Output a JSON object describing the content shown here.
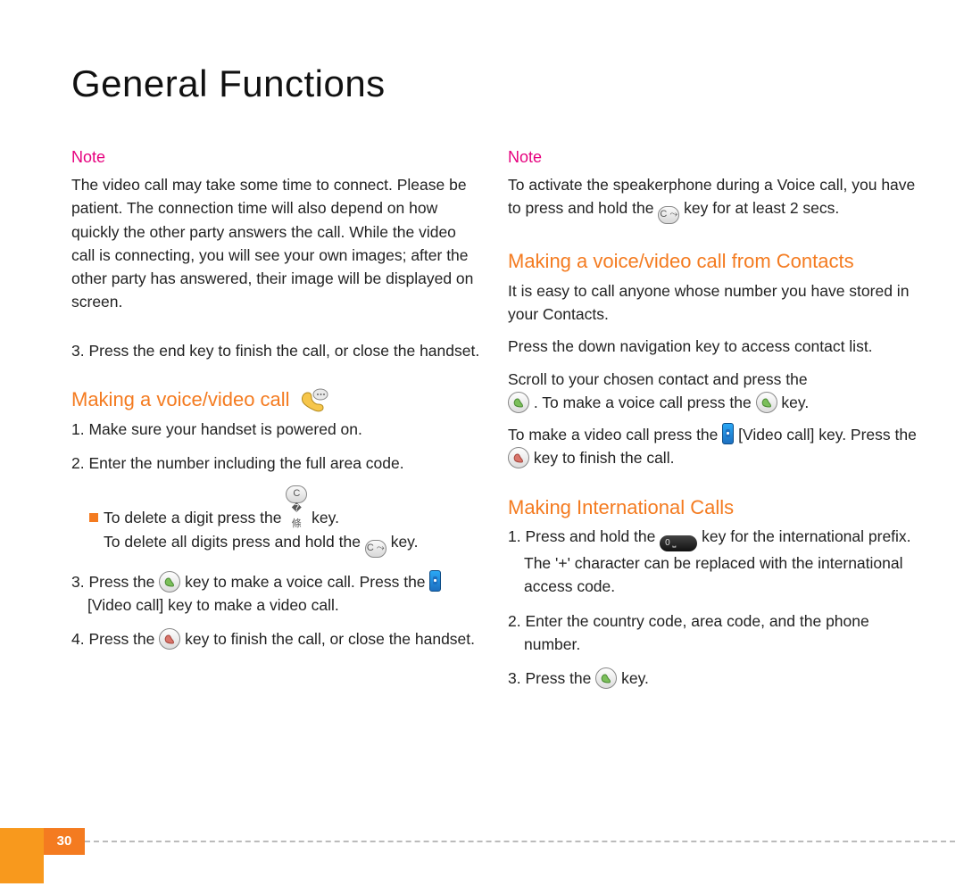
{
  "title": "General Functions",
  "page_number": "30",
  "left": {
    "note_label": "Note",
    "note_body": "The video call may take some time to connect. Please be patient. The connection time will also depend on how quickly the other party answers the call. While the video call is connecting, you will see your own images; after the other party has answered, their image will be displayed on screen.",
    "step3": "3. Press the end key to finish the call, or close the handset.",
    "heading1": "Making a voice/video call",
    "l1": "1. Make sure your handset is powered on.",
    "l2": "2. Enter the number including the full area code.",
    "bullet_a": "To delete a digit press the ",
    "bullet_a2": " key.",
    "bullet_b": "To delete all digits press and hold the ",
    "bullet_b2": " key.",
    "l3a": "3. Press the ",
    "l3b": " key to make a voice call. Press the ",
    "l3c": " [Video call] key to make a video call.",
    "l4a": "4. Press the ",
    "l4b": " key to finish the call, or close the handset."
  },
  "right": {
    "note_label": "Note",
    "note_a": "To activate the speakerphone during a Voice call, you have to press and hold the ",
    "note_b": " key for at least 2 secs.",
    "heading2": "Making a voice/video call from Contacts",
    "p1": "It is easy to call anyone whose number you have stored in your Contacts.",
    "p2": "Press the down navigation key to access contact list.",
    "p3a": "Scroll to your chosen contact and press the ",
    "p3b": " . To make a voice call press the ",
    "p3c": " key.",
    "p4a": "To make a video call press the ",
    "p4b": " [Video call] key. Press the ",
    "p4c": " key to finish the call.",
    "heading3": "Making International Calls",
    "i1a": "1. Press and hold the ",
    "i1b": " key for the international prefix. The '+' character can be replaced with the international access code.",
    "i2": "2. Enter the country code, area code, and the phone number.",
    "i3a": "3. Press the ",
    "i3b": " key."
  }
}
